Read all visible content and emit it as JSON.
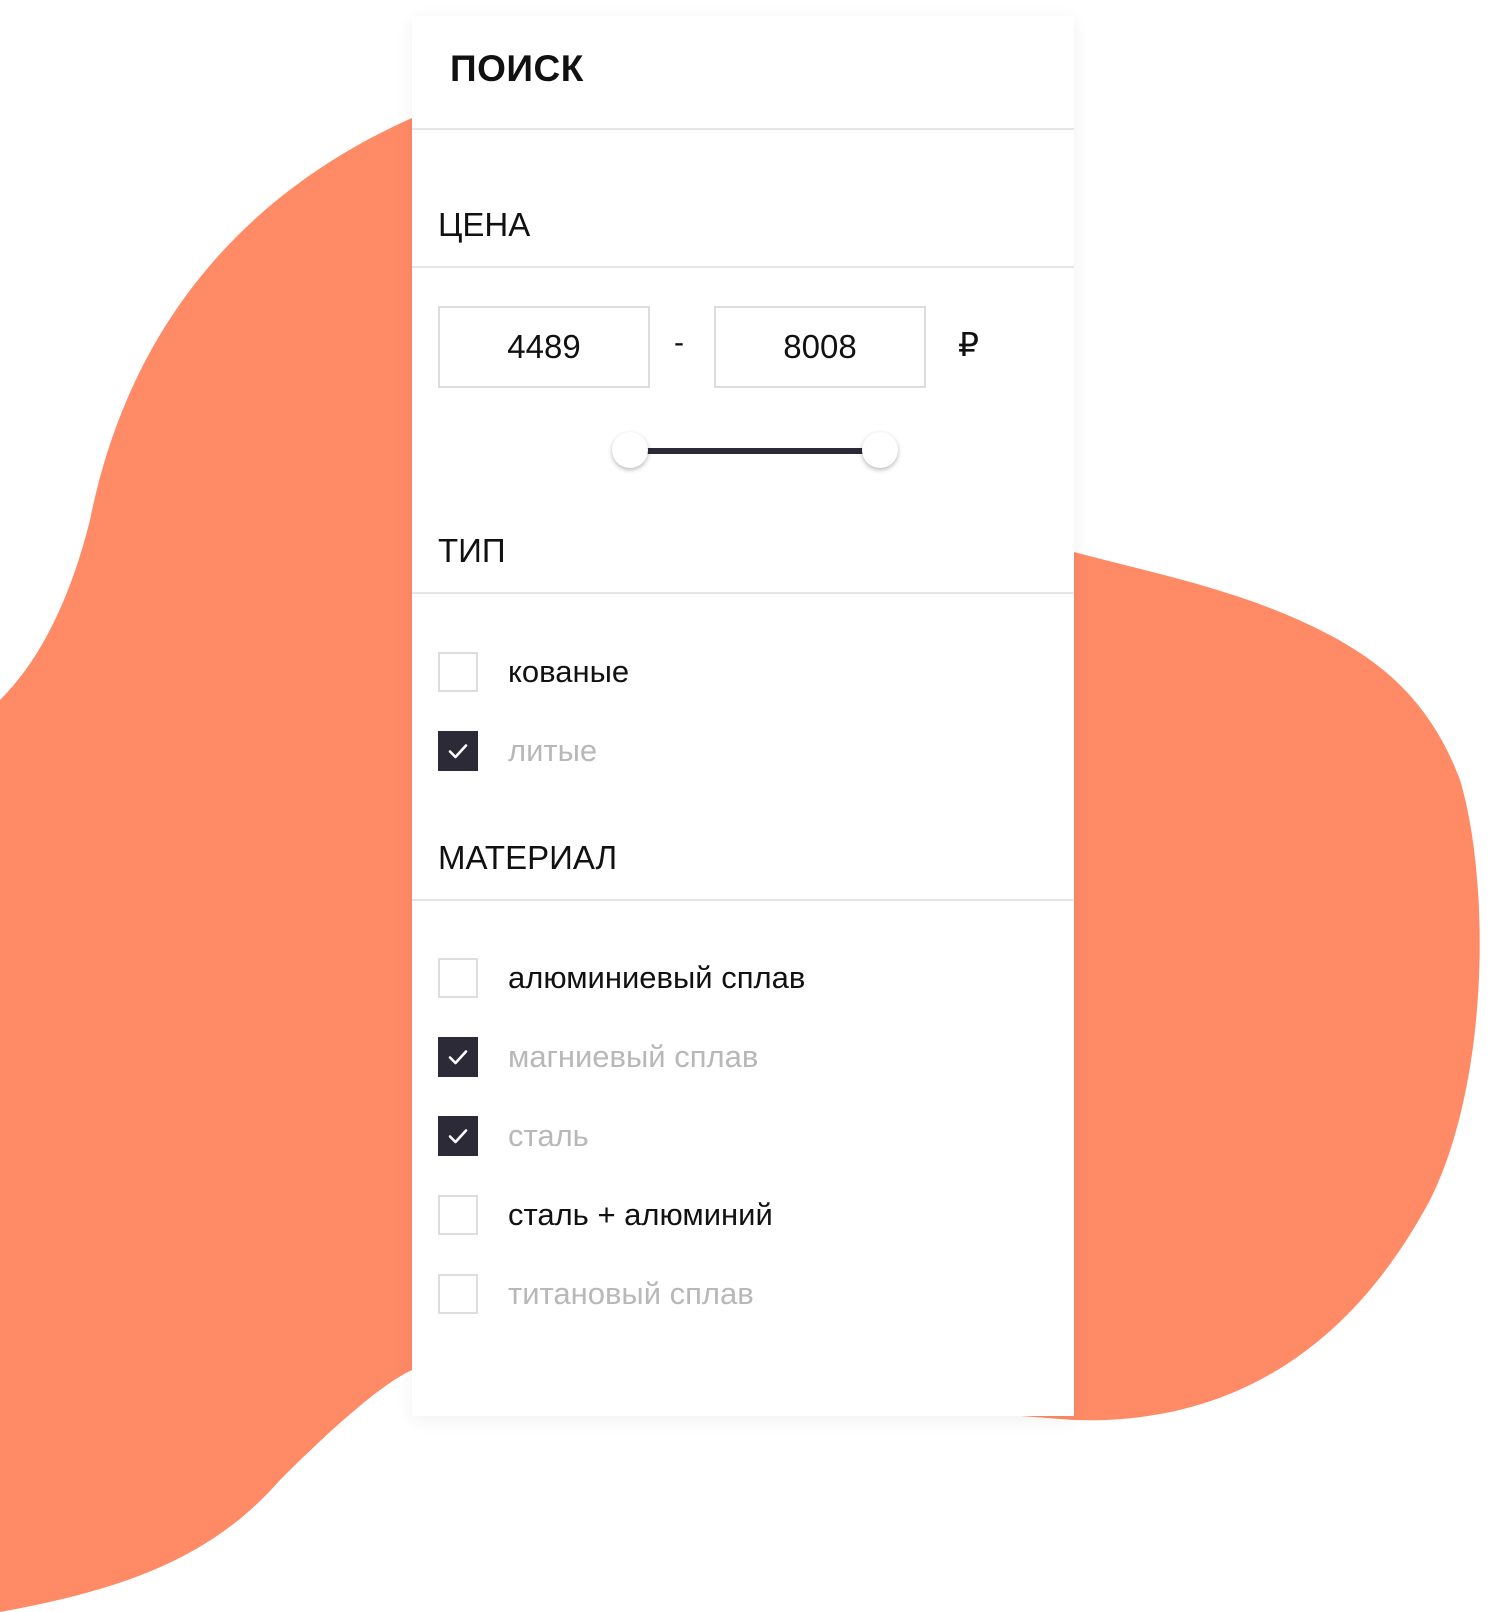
{
  "background": {
    "blob_color": "#ff8a66"
  },
  "panel": {
    "title": "ПОИСК",
    "accent": "#2b2a36",
    "price": {
      "title": "ЦЕНА",
      "min_value": "4489",
      "separator": "-",
      "max_value": "8008",
      "currency": "₽",
      "slider": {
        "lower_fraction": 0.0,
        "upper_fraction": 1.0
      }
    },
    "type": {
      "title": "ТИП",
      "options": [
        {
          "label": "кованые",
          "checked": false
        },
        {
          "label": "литые",
          "checked": true
        }
      ]
    },
    "material": {
      "title": "МАТЕРИАЛ",
      "options": [
        {
          "label": "алюминиевый сплав",
          "checked": false
        },
        {
          "label": "магниевый сплав",
          "checked": true
        },
        {
          "label": "сталь",
          "checked": true
        },
        {
          "label": "сталь + алюминий",
          "checked": false
        },
        {
          "label": "титановый сплав",
          "checked": false,
          "muted": true
        }
      ]
    }
  }
}
